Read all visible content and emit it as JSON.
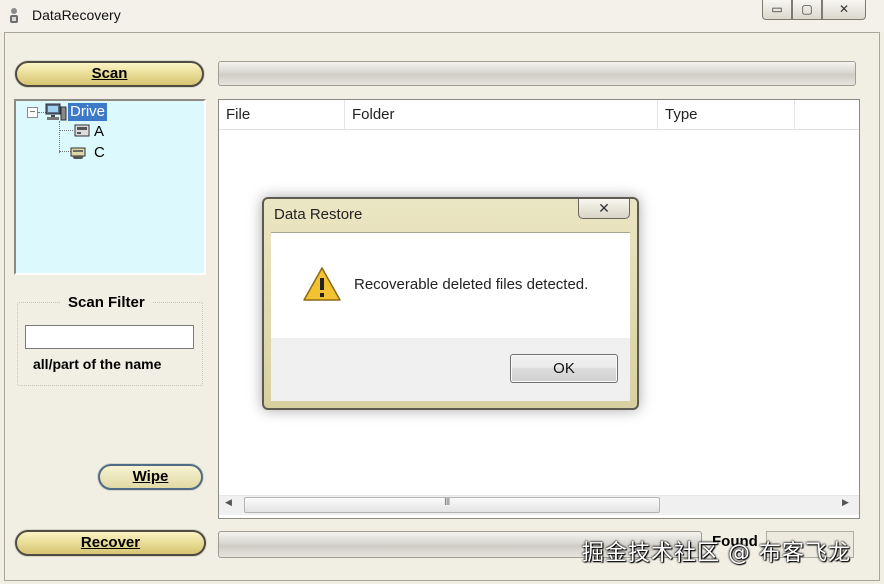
{
  "window": {
    "title": "DataRecovery",
    "minimize_glyph": "▭",
    "maximize_glyph": "▢",
    "close_glyph": "✕"
  },
  "toolbar": {
    "scan_label": "Scan",
    "recover_label": "Recover",
    "wipe_label": "Wipe"
  },
  "tree": {
    "collapse_glyph": "−",
    "root": "Drive",
    "items": [
      {
        "label": "A",
        "icon": "drive-icon"
      },
      {
        "label": "C",
        "icon": "drive-icon"
      }
    ]
  },
  "filter": {
    "title": "Scan Filter",
    "value": "",
    "hint": "all/part of the name"
  },
  "file_list": {
    "columns": [
      "File",
      "Folder",
      "Type"
    ],
    "rows": []
  },
  "scroll": {
    "left_arrow": "◀",
    "right_arrow": "▶",
    "grip": "III"
  },
  "status": {
    "found_label": "Found"
  },
  "dialog": {
    "title": "Data Restore",
    "close_glyph": "✕",
    "message": "Recoverable deleted files detected.",
    "ok_label": "OK",
    "icon": "warning-icon"
  },
  "watermark": "掘金技术社区 @ 布客飞龙",
  "colors": {
    "button_gold": "#e9dc96",
    "tree_background": "#dcf9fd",
    "selection_blue": "#3d79c9",
    "dialog_frame": "#d8d0a0"
  }
}
